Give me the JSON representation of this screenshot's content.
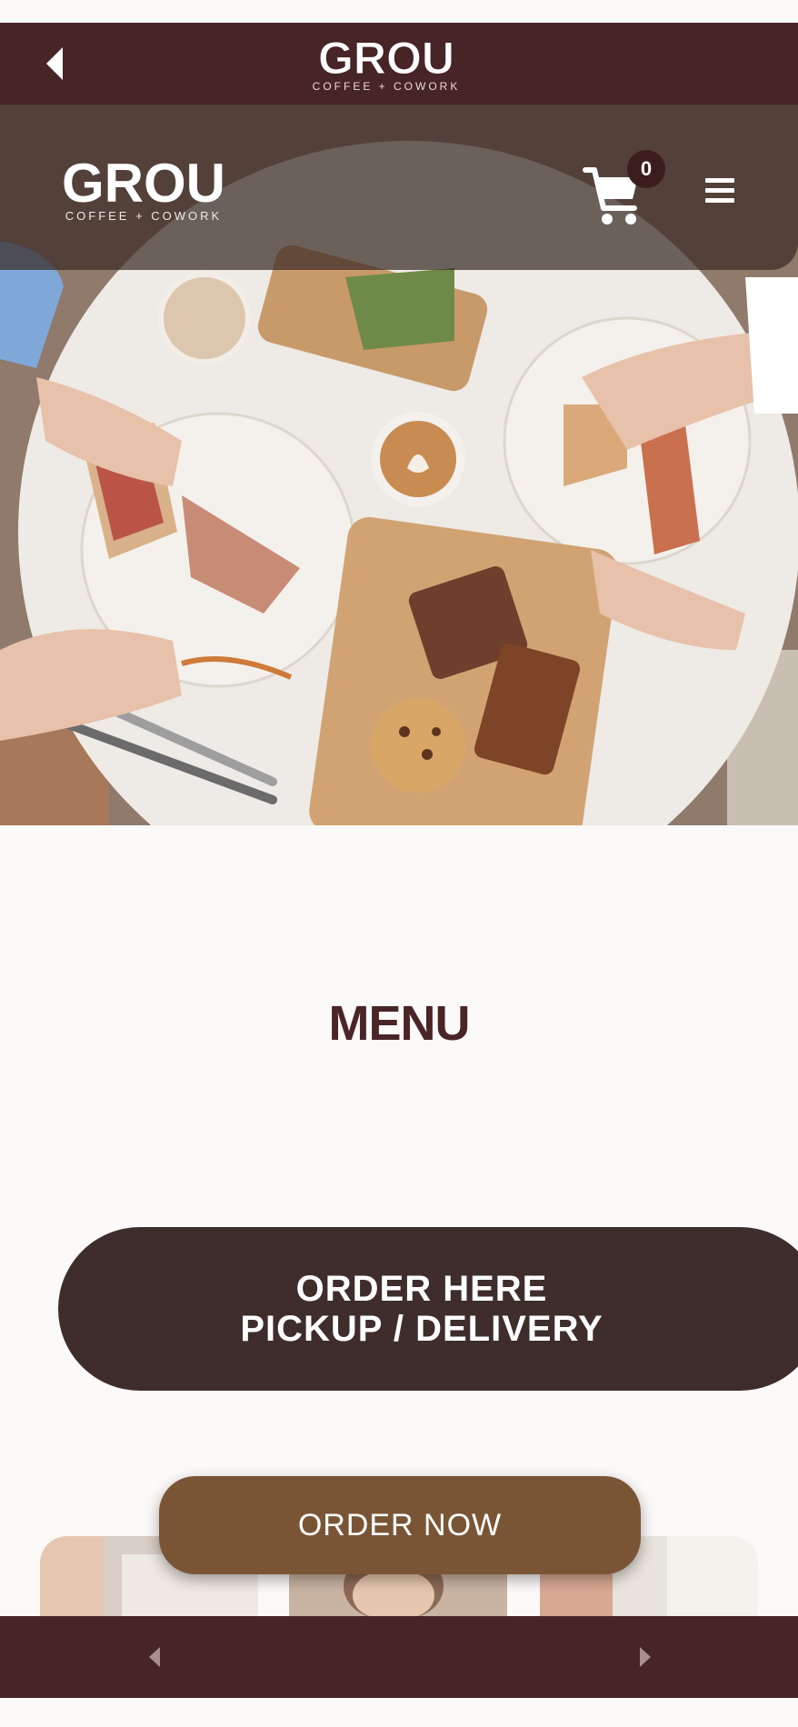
{
  "appbar": {
    "brand": "GROU",
    "tagline": "COFFEE + COWORK"
  },
  "header": {
    "brand": "GROU",
    "tagline": "COFFEE + COWORK",
    "cart_count": "0"
  },
  "icons": {
    "back": "back-arrow-icon",
    "cart": "shopping-cart-icon",
    "menu": "hamburger-menu-icon",
    "prev": "chevron-left-icon",
    "next": "chevron-right-icon"
  },
  "main": {
    "title": "MENU",
    "order_here_line1": "ORDER HERE",
    "order_here_line2": "PICKUP / DELIVERY",
    "order_now": "ORDER NOW"
  },
  "colors": {
    "brand_dark": "#472425",
    "button_dark": "#3e2d2a",
    "accent_brown": "#7a5535",
    "title": "#4a2426"
  }
}
